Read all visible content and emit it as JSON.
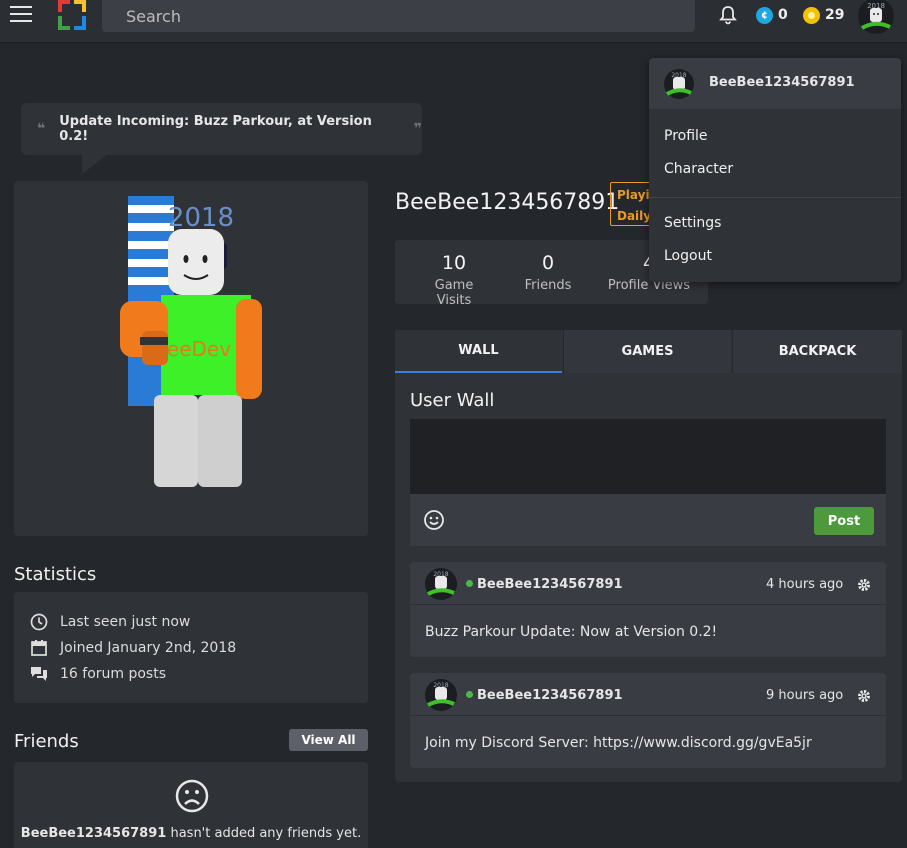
{
  "topbar": {
    "search_placeholder": "Search",
    "bucks_symbol": "¢",
    "bucks": "0",
    "coins": "29",
    "colors": {
      "bucks": "#1ea7e1",
      "coins": "#f2c200"
    }
  },
  "announcement": {
    "text": "Update Incoming: Buzz Parkour, at Version 0.2!",
    "open_quote": "❝",
    "close_quote": "❞"
  },
  "profile": {
    "username": "BeeBee1234567891",
    "status_badge": "Playing Daily]",
    "stats": [
      {
        "value": "10",
        "label": "Game Visits"
      },
      {
        "value": "0",
        "label": "Friends"
      },
      {
        "value": "4",
        "label": "Profile Views"
      }
    ]
  },
  "statistics": {
    "title": "Statistics",
    "rows": [
      {
        "icon": "clock-icon",
        "text": "Last seen just now"
      },
      {
        "icon": "calendar-icon",
        "text": "Joined January 2nd, 2018"
      },
      {
        "icon": "forum-icon",
        "text": "16 forum posts"
      }
    ]
  },
  "friends": {
    "title": "Friends",
    "view_all": "View All",
    "empty_name": "BeeBee1234567891",
    "empty_text": " hasn't added any friends yet."
  },
  "tabs": [
    "WALL",
    "GAMES",
    "BACKPACK"
  ],
  "wall": {
    "title": "User Wall",
    "post_button": "Post",
    "posts": [
      {
        "author": "BeeBee1234567891",
        "time": "4 hours ago",
        "text": "Buzz Parkour Update: Now at Version 0.2!"
      },
      {
        "author": "BeeBee1234567891",
        "time": "9 hours ago",
        "text": "Join my Discord Server: https://www.discord.gg/gvEa5jr"
      }
    ]
  },
  "dropdown": {
    "username": "BeeBee1234567891",
    "items": [
      "Profile",
      "Character",
      "Settings",
      "Logout"
    ]
  },
  "avatar": {
    "shirt_text": "eeDev",
    "hat_text": "2018"
  }
}
